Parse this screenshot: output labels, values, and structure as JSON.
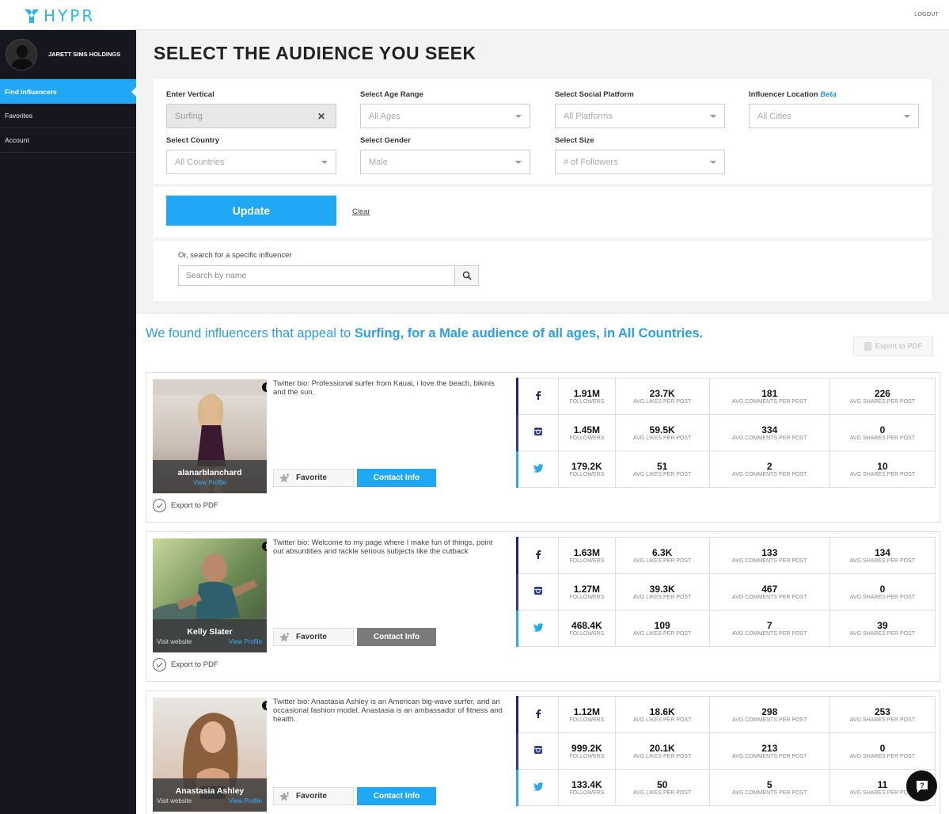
{
  "app": {
    "logo_text": "HYPR",
    "logout": "LOGOUT"
  },
  "sidebar": {
    "profile_name": "JARETT SIMS HOLDINGS",
    "items": [
      {
        "label": "Find Influencers"
      },
      {
        "label": "Favorites"
      },
      {
        "label": "Account"
      }
    ]
  },
  "page": {
    "title": "SELECT THE AUDIENCE YOU SEEK"
  },
  "filters": {
    "vertical": {
      "label": "Enter Vertical",
      "value": "Surfing"
    },
    "age": {
      "label": "Select Age Range",
      "value": "All Ages"
    },
    "platform": {
      "label": "Select Social Platform",
      "value": "All Platforms"
    },
    "location": {
      "label": "Influencer Location",
      "beta": "Beta",
      "value": "All Cities"
    },
    "country": {
      "label": "Select Country",
      "value": "All Countries"
    },
    "gender": {
      "label": "Select Gender",
      "value": "Male"
    },
    "size": {
      "label": "Select Size",
      "value": "# of Followers"
    }
  },
  "actions": {
    "update": "Update",
    "clear": "Clear"
  },
  "search": {
    "label": "Or, search for a specific influencer",
    "placeholder": "Search by name"
  },
  "results": {
    "prefix": "We found influencers that appeal to ",
    "highlight": "Surfing, for a Male audience of all ages, in All Countries.",
    "export_pdf": "Export to PDF"
  },
  "card_labels": {
    "favorite": "Favorite",
    "contact": "Contact Info",
    "export": "Export to PDF",
    "view_profile": "View Profile",
    "visit_website": "Visit website",
    "followers": "FOLLOWERS",
    "avg_likes": "AVG LIKES PER POST",
    "avg_comments": "AVG COMMENTS PER POST",
    "avg_shares": "AVG SHARES PER POST"
  },
  "colors": {
    "accent": "#21a8f5",
    "sidebar_bg": "#16161e",
    "contact_disabled": "#7a7a7a"
  },
  "influencers": [
    {
      "name": "alanarblanchard",
      "bio": "Twitter bio: Professional surfer from Kauai, i love the beach, bikinis and the sun.",
      "contact_color": "#21a8f5",
      "stats": [
        {
          "platform": "facebook",
          "followers": "1.91M",
          "likes": "23.7K",
          "comments": "181",
          "shares": "226"
        },
        {
          "platform": "instagram",
          "followers": "1.45M",
          "likes": "59.5K",
          "comments": "334",
          "shares": "0"
        },
        {
          "platform": "twitter",
          "followers": "179.2K",
          "likes": "51",
          "comments": "2",
          "shares": "10"
        }
      ]
    },
    {
      "name": "Kelly Slater",
      "bio": "Twitter bio: Welcome to my page where I make fun of things, point out absurdities and tackle serious subjects like the cutback",
      "contact_color": "#7a7a7a",
      "stats": [
        {
          "platform": "facebook",
          "followers": "1.63M",
          "likes": "6.3K",
          "comments": "133",
          "shares": "134"
        },
        {
          "platform": "instagram",
          "followers": "1.27M",
          "likes": "39.3K",
          "comments": "467",
          "shares": "0"
        },
        {
          "platform": "twitter",
          "followers": "468.4K",
          "likes": "109",
          "comments": "7",
          "shares": "39"
        }
      ]
    },
    {
      "name": "Anastasia Ashley",
      "bio": "Twitter bio: Anastasia Ashley is an American big-wave surfer, and an occasional fashion model. Anastasia is an ambassador of fitness and health.",
      "contact_color": "#21a8f5",
      "stats": [
        {
          "platform": "facebook",
          "followers": "1.12M",
          "likes": "18.6K",
          "comments": "298",
          "shares": "253"
        },
        {
          "platform": "instagram",
          "followers": "999.2K",
          "likes": "20.1K",
          "comments": "213",
          "shares": "0"
        },
        {
          "platform": "twitter",
          "followers": "133.4K",
          "likes": "50",
          "comments": "5",
          "shares": "11"
        }
      ]
    }
  ]
}
